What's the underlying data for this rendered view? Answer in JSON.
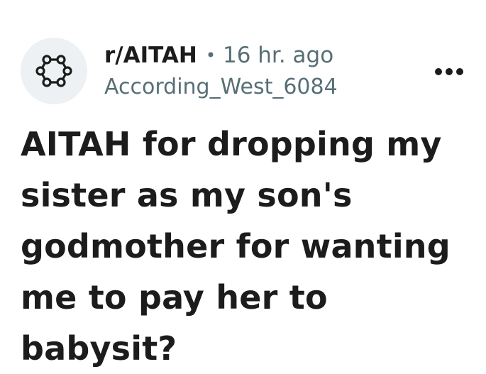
{
  "post": {
    "subreddit": "r/AITAH",
    "separator": "•",
    "time_ago": "16 hr. ago",
    "author": "According_West_6084",
    "title": "AITAH for dropping my sister as my son's godmother for wanting me to pay her to babysit?"
  },
  "icons": {
    "avatar": "subreddit-default-icon",
    "more": "overflow-menu-icon"
  },
  "colors": {
    "text_primary": "#1c1c1c",
    "text_secondary": "#576f76",
    "avatar_background": "#eef1f3"
  }
}
